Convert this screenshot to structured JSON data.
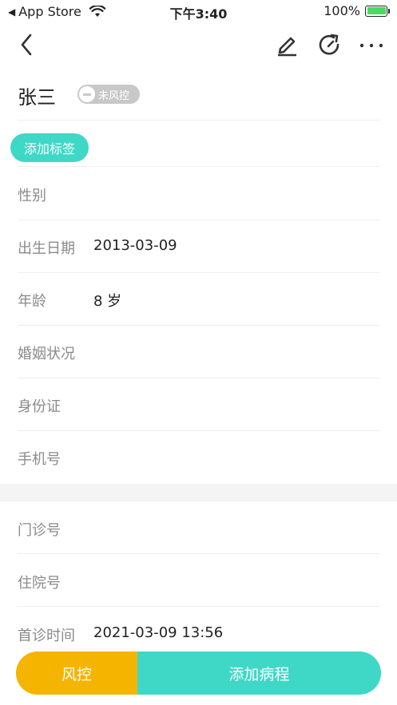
{
  "status_bar": {
    "back_app": "App Store",
    "time": "下午3:40",
    "battery": "100%"
  },
  "nav": {
    "icons": [
      "back-icon",
      "edit-icon",
      "refresh-icon",
      "more-icon"
    ]
  },
  "patient": {
    "name": "张三",
    "risk_badge": "未风控",
    "add_tag_label": "添加标签"
  },
  "fields": [
    {
      "label": "性别",
      "value": ""
    },
    {
      "label": "出生日期",
      "value": "2013-03-09"
    },
    {
      "label": "年龄",
      "value": "8 岁"
    },
    {
      "label": "婚姻状况",
      "value": ""
    },
    {
      "label": "身份证",
      "value": ""
    },
    {
      "label": "手机号",
      "value": ""
    }
  ],
  "fields2": [
    {
      "label": "门诊号",
      "value": ""
    },
    {
      "label": "住院号",
      "value": ""
    },
    {
      "label": "首诊时间",
      "value": "2021-03-09 13:56"
    }
  ],
  "bottom": {
    "risk_label": "风控",
    "add_course_label": "添加病程"
  },
  "colors": {
    "accent": "#3fd8c6",
    "warning": "#f5b400",
    "badge_gray": "#c8c8c8"
  }
}
